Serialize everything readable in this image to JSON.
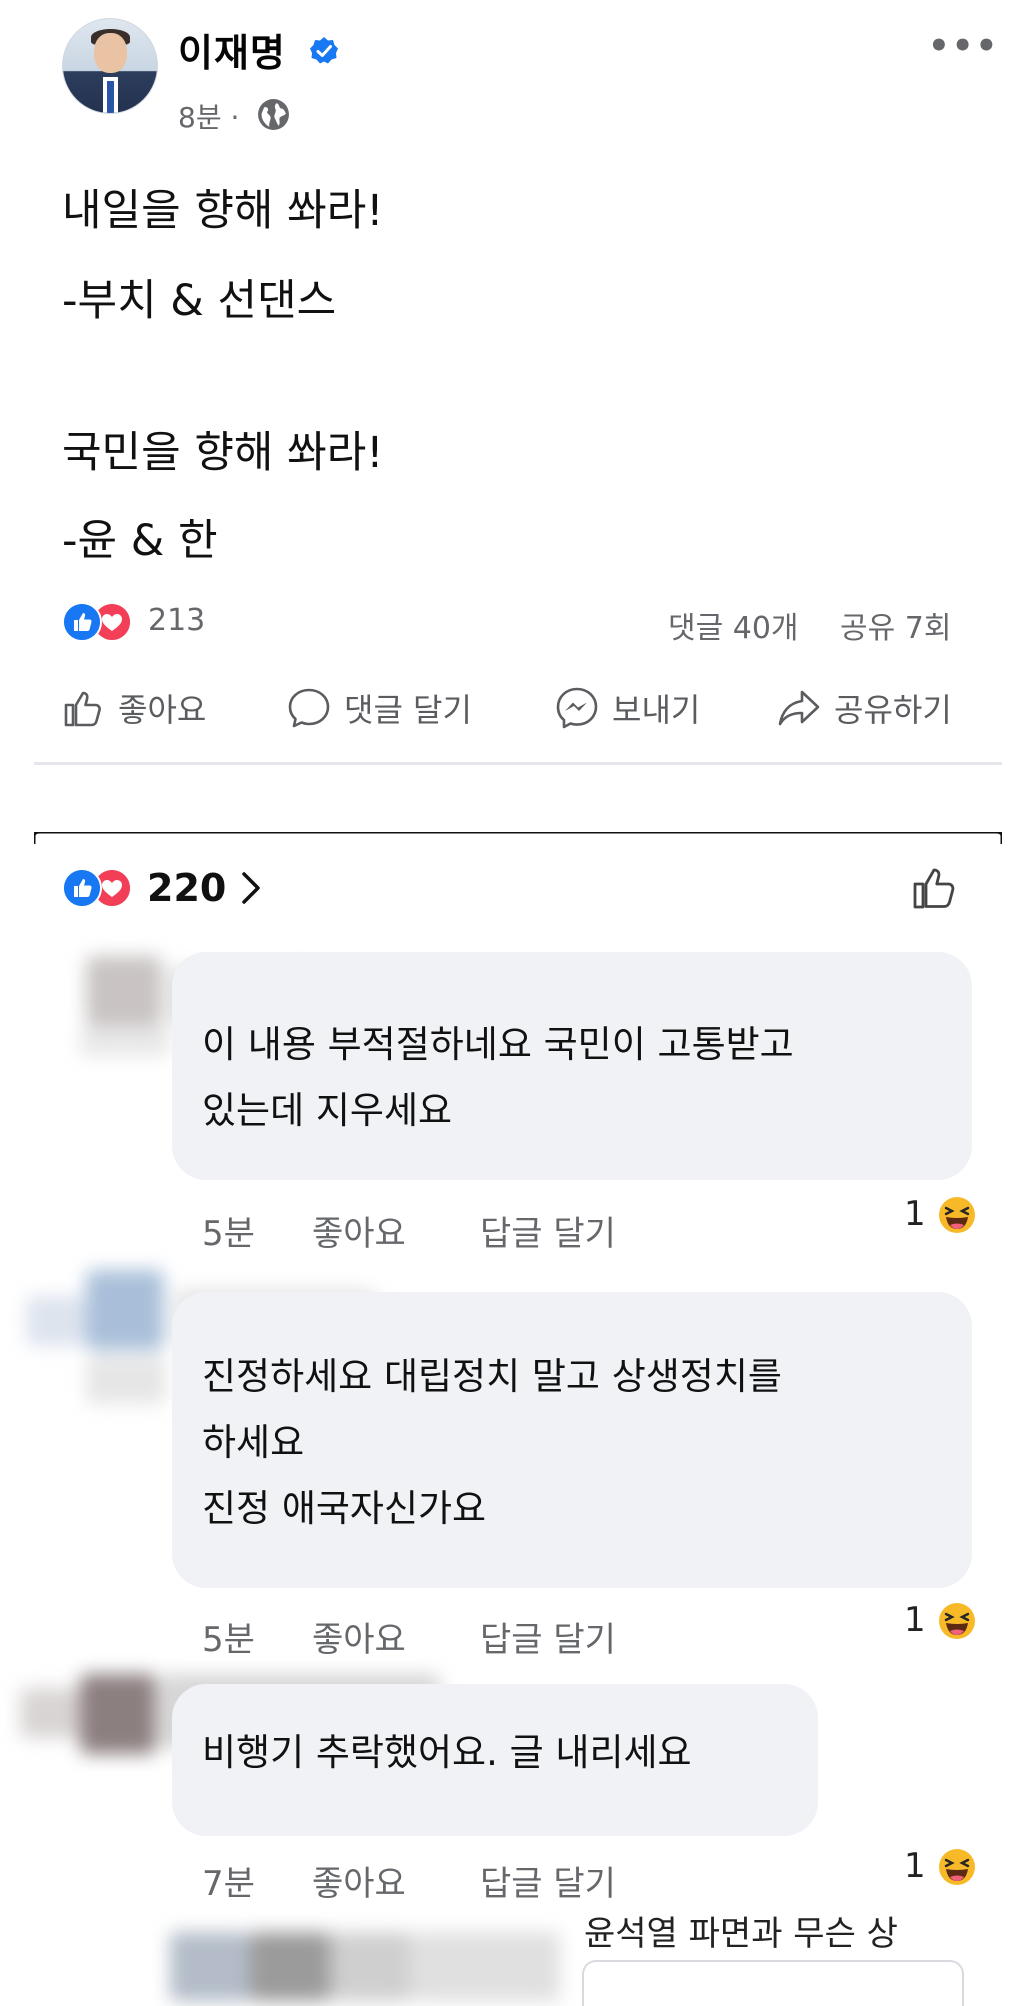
{
  "post": {
    "author": "이재명",
    "time": "8분 ·",
    "lines": [
      "내일을 향해 쏴라!",
      "-부치 & 선댄스",
      "국민을 향해 쏴라!",
      "-윤 & 한"
    ],
    "reaction_count": "213",
    "comment_count": "댓글 40개",
    "share_count": "공유 7회"
  },
  "actions": {
    "like": "좋아요",
    "comment": "댓글 달기",
    "send": "보내기",
    "share": "공유하기"
  },
  "comments_header": {
    "reaction_count": "220"
  },
  "comments": [
    {
      "lines": [
        "이 내용 부적절하네요   국민이 고통받고",
        "있는데  지우세요"
      ],
      "time": "5분",
      "like": "좋아요",
      "reply": "답글 달기",
      "reaction_count": "1"
    },
    {
      "lines": [
        "진정하세요 대립정치 말고 상생정치를",
        "하세요",
        "진정 애국자신가요"
      ],
      "time": "5분",
      "like": "좋아요",
      "reply": "답글 달기",
      "reaction_count": "1"
    },
    {
      "lines": [
        "비행기 추락했어요. 글 내리세요"
      ],
      "time": "7분",
      "like": "좋아요",
      "reply": "답글 달기",
      "reaction_count": "1"
    }
  ],
  "partial_comment": "윤석열 파면과 무슨 상",
  "icons": {
    "verified": "verified-badge-icon",
    "audience": "globe-icon",
    "menu": "more-options-icon",
    "like_reaction": "like-reaction-icon",
    "love_reaction": "love-reaction-icon",
    "haha_reaction": "haha-reaction-icon"
  },
  "colors": {
    "facebook_blue": "#1877f2",
    "love_red": "#f33e58",
    "haha_yellow": "#f7b928",
    "bubble_bg": "#f0f2f5",
    "secondary_text": "#65676b"
  }
}
